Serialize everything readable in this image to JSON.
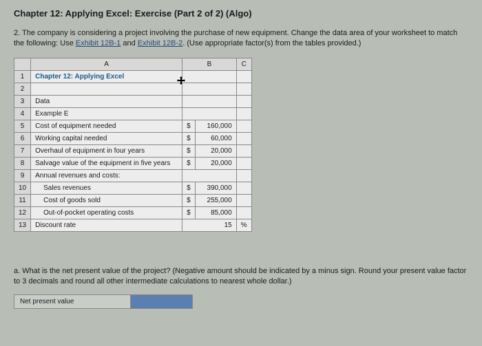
{
  "title": "Chapter 12: Applying Excel: Exercise (Part 2 of 2) (Algo)",
  "question_prefix": "2. The company is considering a project involving the purchase of new equipment. Change the data area of your worksheet to match the following: Use ",
  "link1": "Exhibit 12B-1",
  "question_mid": " and ",
  "link2": "Exhibit 12B-2",
  "question_suffix": ". (Use appropriate factor(s) from the tables provided.)",
  "col_a": "A",
  "col_b": "B",
  "col_c": "C",
  "rows": {
    "r1n": "1",
    "r1a": "Chapter 12: Applying Excel",
    "r2n": "2",
    "r3n": "3",
    "r3a": "Data",
    "r4n": "4",
    "r4a": "Example E",
    "r5n": "5",
    "r5a": "Cost of equipment needed",
    "r5b": "160,000",
    "r5c": "$",
    "r6n": "6",
    "r6a": "Working capital needed",
    "r6b": "60,000",
    "r6c": "$",
    "r7n": "7",
    "r7a": "Overhaul of equipment in four years",
    "r7b": "20,000",
    "r7c": "$",
    "r8n": "8",
    "r8a": "Salvage value of the equipment in five years",
    "r8b": "20,000",
    "r8c": "$",
    "r9n": "9",
    "r9a": "Annual revenues and costs:",
    "r10n": "10",
    "r10a": "Sales revenues",
    "r10b": "390,000",
    "r10c": "$",
    "r11n": "11",
    "r11a": "Cost of goods sold",
    "r11b": "255,000",
    "r11c": "$",
    "r12n": "12",
    "r12a": "Out-of-pocket operating costs",
    "r12b": "85,000",
    "r12c": "$",
    "r13n": "13",
    "r13a": "Discount rate",
    "r13b": "15",
    "r13c2": "%"
  },
  "sub_q": "a. What is the net present value of the project? (Negative amount should be indicated by a minus sign. Round your present value factor to 3 decimals and round all other intermediate calculations to nearest whole dollar.)",
  "npv_label": "Net present value"
}
